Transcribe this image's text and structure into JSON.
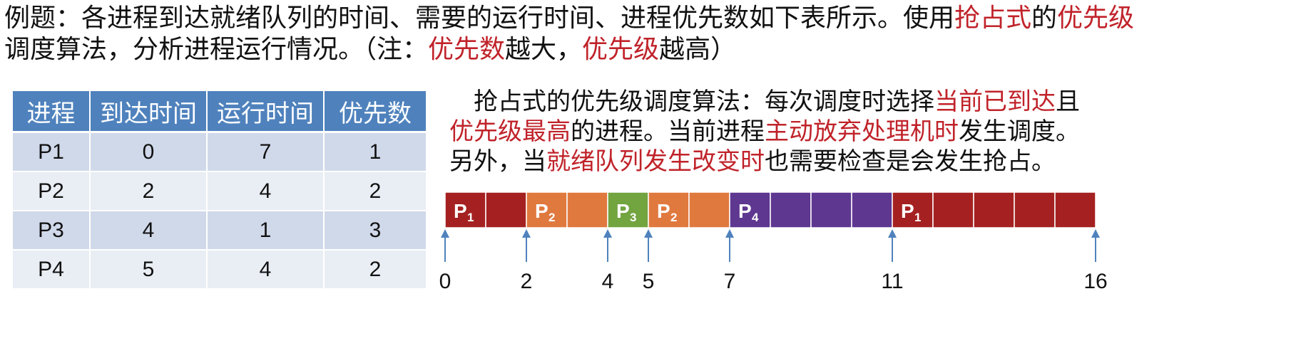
{
  "header": {
    "line1": [
      {
        "text": "例题：各进程到达就绪队列的时间、需要的运行时间、进程优先数如下表所示。使用",
        "red": false
      },
      {
        "text": "抢占式",
        "red": true
      },
      {
        "text": "的",
        "red": false
      },
      {
        "text": "优先级",
        "red": true
      }
    ],
    "line2": [
      {
        "text": "调度算法，分析进程运行情况。（注：",
        "red": false
      },
      {
        "text": "优先数",
        "red": true
      },
      {
        "text": "越大，",
        "red": false
      },
      {
        "text": "优先级",
        "red": true
      },
      {
        "text": "越高）",
        "red": false
      }
    ]
  },
  "table": {
    "headers": [
      "进程",
      "到达时间",
      "运行时间",
      "优先数"
    ],
    "rows": [
      [
        "P1",
        "0",
        "7",
        "1"
      ],
      [
        "P2",
        "2",
        "4",
        "2"
      ],
      [
        "P3",
        "4",
        "1",
        "3"
      ],
      [
        "P4",
        "5",
        "4",
        "2"
      ]
    ]
  },
  "description": {
    "lines": [
      [
        {
          "text": "抢占式的优先级调度算法：每次调度时选择",
          "red": false
        },
        {
          "text": "当前已到达",
          "red": true
        },
        {
          "text": "且",
          "red": false
        }
      ],
      [
        {
          "text": "优先级最高",
          "red": true
        },
        {
          "text": "的进程。当前进程",
          "red": false
        },
        {
          "text": "主动放弃处理机时",
          "red": true
        },
        {
          "text": "发生调度。",
          "red": false
        }
      ],
      [
        {
          "text": "另外，当",
          "red": false
        },
        {
          "text": "就绪队列发生改变时",
          "red": true
        },
        {
          "text": "也需要检查是会发生抢占。",
          "red": false
        }
      ]
    ]
  },
  "gantt": {
    "colors": {
      "P1": "#a52121",
      "P2": "#e0793e",
      "P3": "#72a440",
      "P4": "#5e3790"
    },
    "segments": [
      {
        "process": "P1",
        "start": 0,
        "end": 2,
        "label": "P",
        "sub": "1"
      },
      {
        "process": "P2",
        "start": 2,
        "end": 4,
        "label": "P",
        "sub": "2"
      },
      {
        "process": "P3",
        "start": 4,
        "end": 5,
        "label": "P",
        "sub": "3"
      },
      {
        "process": "P2",
        "start": 5,
        "end": 7,
        "label": "P",
        "sub": "2"
      },
      {
        "process": "P4",
        "start": 7,
        "end": 11,
        "label": "P",
        "sub": "4"
      },
      {
        "process": "P1",
        "start": 11,
        "end": 16,
        "label": "P",
        "sub": "1"
      }
    ],
    "ticks": [
      0,
      2,
      4,
      5,
      7,
      11,
      16
    ]
  }
}
